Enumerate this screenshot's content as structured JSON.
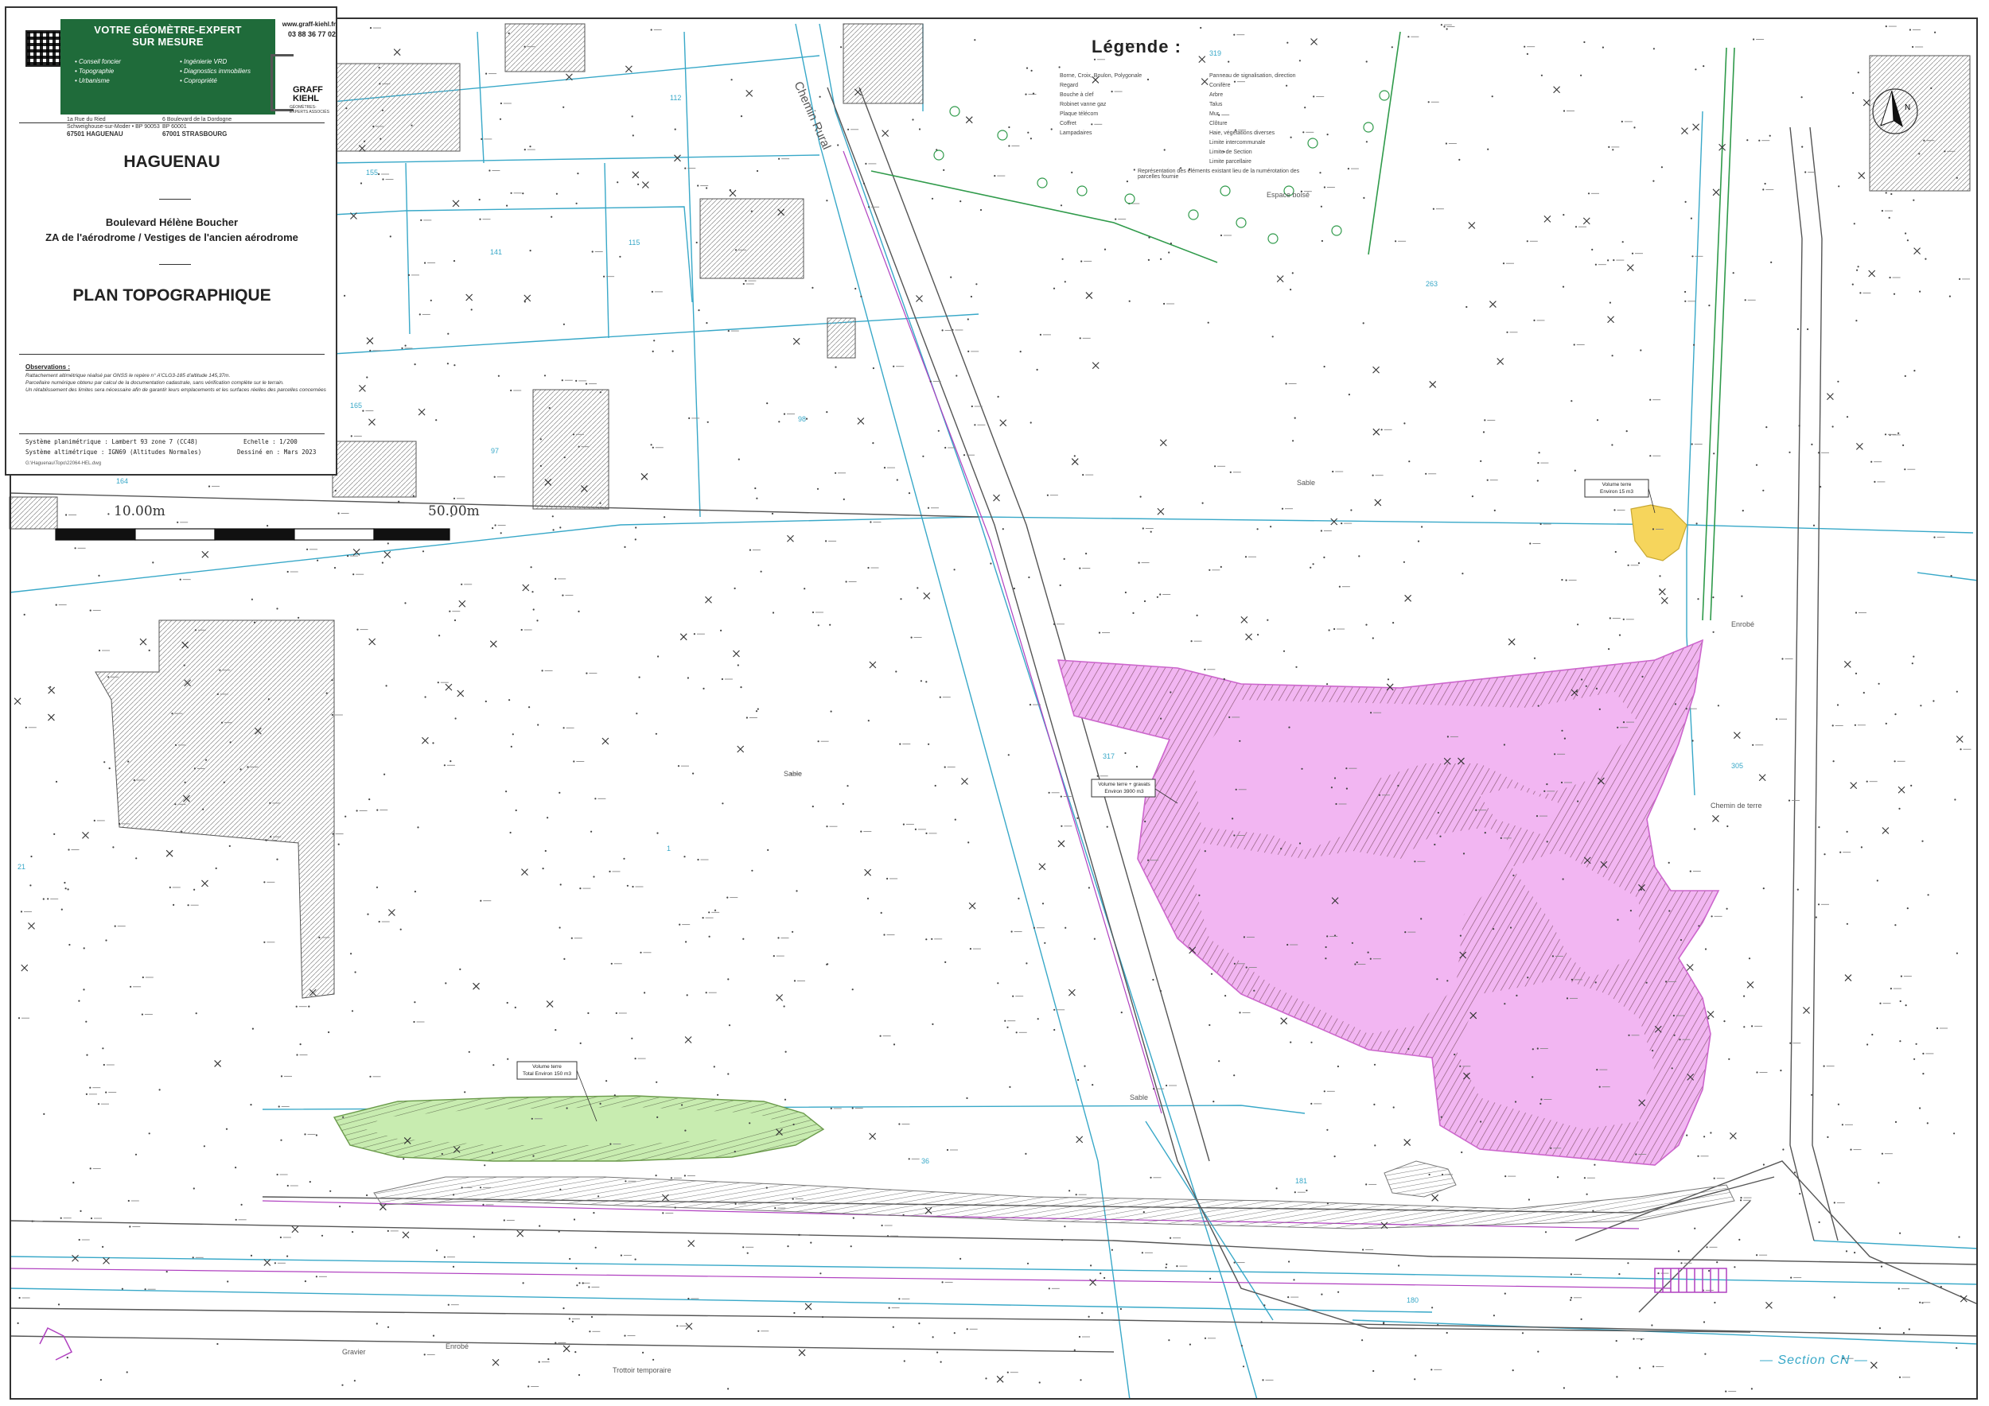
{
  "cartouche": {
    "slogan": [
      "VOTRE GÉOMÈTRE-EXPERT",
      "SUR MESURE"
    ],
    "website": "www.graff-kiehl.fr",
    "phone": "03 88 36 77 02",
    "services_left": [
      "Conseil foncier",
      "Topographie",
      "Urbanisme"
    ],
    "services_right": [
      "Ingénierie VRD",
      "Diagnostics immobiliers",
      "Copropriété"
    ],
    "logo_name": [
      "GRAFF",
      "KIEHL"
    ],
    "logo_tagline": "GÉOMÈTRES-EXPERTS ASSOCIÉS",
    "office1": [
      "1a Rue du Ried",
      "Schweighouse-sur-Moder • BP 90053",
      "67501 HAGUENAU"
    ],
    "office2": [
      "6 Boulevard de la Dordogne",
      "BP 60001",
      "67001 STRASBOURG"
    ],
    "city": "HAGUENAU",
    "address_line1": "Boulevard Hélène Boucher",
    "address_line2": "ZA de l'aérodrome / Vestiges de l'ancien aérodrome",
    "plan_title": "PLAN TOPOGRAPHIQUE",
    "observations_title": "Observations :",
    "observations": [
      "Rattachement altimétrique réalisé par GNSS le repère n° A'CLG3-185 d'altitude 145,37m.",
      "Parcellaire numérique obtenu par calcul de la documentation cadastrale, sans vérification complète sur le terrain.",
      "Un rétablissement des limites sera nécessaire afin de garantir leurs emplacements et les surfaces réelles des parcelles concernées"
    ],
    "system_planimetric_label": "Système planimétrique :",
    "system_planimetric_value": "Lambert 93 zone 7 (CC48)",
    "system_altimetric_label": "Système altimétrique :",
    "system_altimetric_value": "IGN69 (Altitudes Normales)",
    "scale_label": "Echelle :",
    "scale_value": "1/200",
    "drawn_label": "Dessiné en :",
    "drawn_value": "Mars 2023",
    "file_ref": "G:\\Haguenau\\Topo\\22064-HEL.dwg"
  },
  "legend": {
    "title": "Légende :",
    "left": [
      "Borne, Croix, Boulon, Polygonale",
      "Regard",
      "Bouche à clef",
      "Robinet vanne gaz",
      "Plaque télécom",
      "Coffret",
      "Lampadaires"
    ],
    "right": [
      "Panneau de signalisation, direction",
      "Conifère",
      "Arbre",
      "Talus",
      "Mur",
      "Clôture",
      "Haie, végétations diverses",
      "Limite intercommunale",
      "Limite de Section",
      "Limite parcellaire",
      "Représentation des éléments existant lieu de la numérotation des parcelles fournie"
    ]
  },
  "scale_bar": {
    "label_small": "10.00m",
    "label_large": "50.00m"
  },
  "annotations": {
    "chemin_rural": "Chemin Rural",
    "section": "Section CN",
    "volume_pink_title": "Volume terre + gravats",
    "volume_pink_value": "Environ 3900 m3",
    "volume_green_title": "Volume terre",
    "volume_green_value": "Total Environ 150 m3",
    "volume_yellow_title": "Volume terre",
    "volume_yellow_value": "Environ 15 m3",
    "chemin_de_terre": "Chemin de terre",
    "trottoir": "Trottoir temporaire",
    "espace_boise": "Espace boisé",
    "enrobe": "Enrobé",
    "sable": "Sable",
    "gravier": "Gravier",
    "sable_label": "Sable"
  },
  "parcels": [
    "112",
    "155",
    "141",
    "115",
    "165",
    "97",
    "98",
    "319",
    "263",
    "317",
    "305",
    "36",
    "181",
    "180",
    "21",
    "164",
    "1"
  ],
  "colors": {
    "parcel_line": "#38a8c8",
    "pink_fill": "#f2b6f2",
    "pink_border": "#cc66cc",
    "green_fill": "#c8ecb0",
    "yellow_fill": "#f6d55c",
    "cartouche_green": "#1f6b3a"
  }
}
